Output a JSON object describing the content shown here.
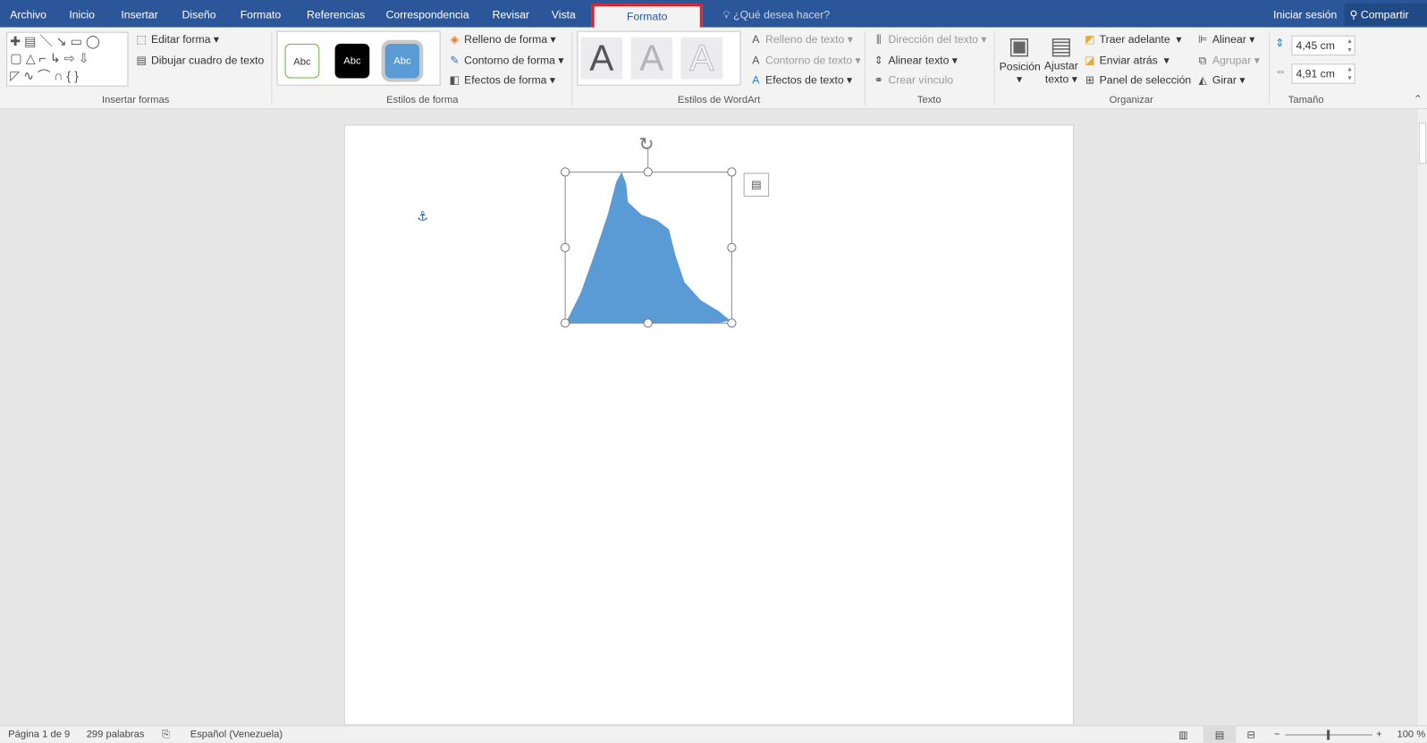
{
  "tabs": [
    "Archivo",
    "Inicio",
    "Insertar",
    "Diseño",
    "Formato",
    "Referencias",
    "Correspondencia",
    "Revisar",
    "Vista"
  ],
  "active_tab": "Formato",
  "tell_me": "¿Qué desea hacer?",
  "sign_in": "Iniciar sesión",
  "share": "Compartir",
  "groups": {
    "insert_shapes": {
      "label": "Insertar formas",
      "edit_shape": "Editar forma",
      "draw_textbox": "Dibujar cuadro de texto"
    },
    "shape_styles": {
      "label": "Estilos de forma",
      "styles": [
        "Abc",
        "Abc",
        "Abc"
      ],
      "fill": "Relleno de forma",
      "outline": "Contorno de forma",
      "effects": "Efectos de forma"
    },
    "wordart": {
      "label": "Estilos de WordArt",
      "letters": [
        "A",
        "A",
        "A"
      ],
      "fill": "Relleno de texto",
      "outline": "Contorno de texto",
      "effects": "Efectos de texto"
    },
    "text": {
      "label": "Texto",
      "direction": "Dirección del texto",
      "align": "Alinear texto",
      "link": "Crear vínculo"
    },
    "arrange": {
      "label": "Organizar",
      "position": "Posición",
      "wrap1": "Ajustar",
      "wrap2": "texto",
      "forward": "Traer adelante",
      "backward": "Enviar atrás",
      "selection_pane": "Panel de selección",
      "align": "Alinear",
      "group": "Agrupar",
      "rotate": "Girar"
    },
    "size": {
      "label": "Tamaño",
      "height": "4,45 cm",
      "width": "4,91 cm"
    }
  },
  "status": {
    "page": "Página 1 de 9",
    "words": "299 palabras",
    "language": "Español (Venezuela)",
    "zoom": "100 %",
    "zoom_percent": 100
  },
  "colors": {
    "titlebar": "#2b579a",
    "shape_fill": "#5b9bd5",
    "highlight": "#d9232a"
  }
}
